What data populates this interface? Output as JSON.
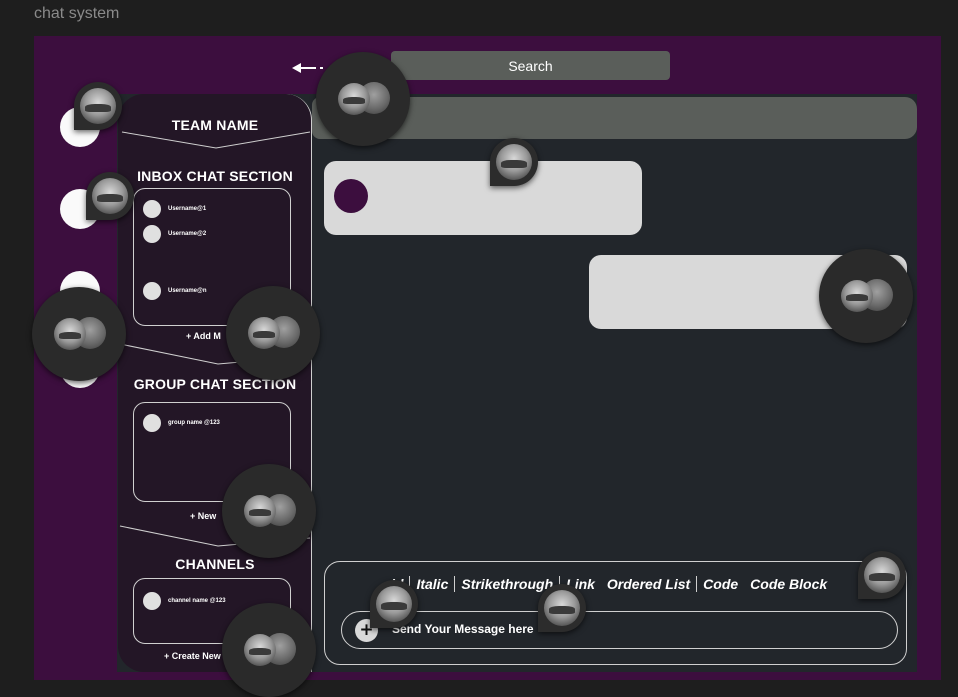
{
  "frame": {
    "label": "chat system"
  },
  "search": {
    "label": "Search"
  },
  "sidebar": {
    "team_name": "TEAM NAME",
    "inbox_title": "INBOX CHAT SECTION",
    "inbox_users": [
      "Username@1",
      "Username@2",
      "Username@n"
    ],
    "add_member_label": "+    Add M",
    "group_title": "GROUP CHAT SECTION",
    "groups": [
      "group name @123"
    ],
    "new_group_label": "+    New",
    "channels_title": "CHANNELS",
    "channels": [
      "channel name @123"
    ],
    "create_channel_label": "+   Create New"
  },
  "composer": {
    "format_items": [
      "ld",
      "Italic",
      "Strikethrough",
      "Link",
      "Ordered List",
      "Code",
      "Code Block"
    ],
    "placeholder": "Send Your Message here",
    "plus_label": "+"
  },
  "colors": {
    "frame_bg": "#3c0e3e",
    "app_bg": "#22262b",
    "sidebar_bg": "#231626",
    "bubble": "#d9d9d9",
    "header": "#5a5e5a"
  },
  "icons": [
    "back-arrow-icon",
    "plus-icon",
    "comment-avatar-icon"
  ]
}
